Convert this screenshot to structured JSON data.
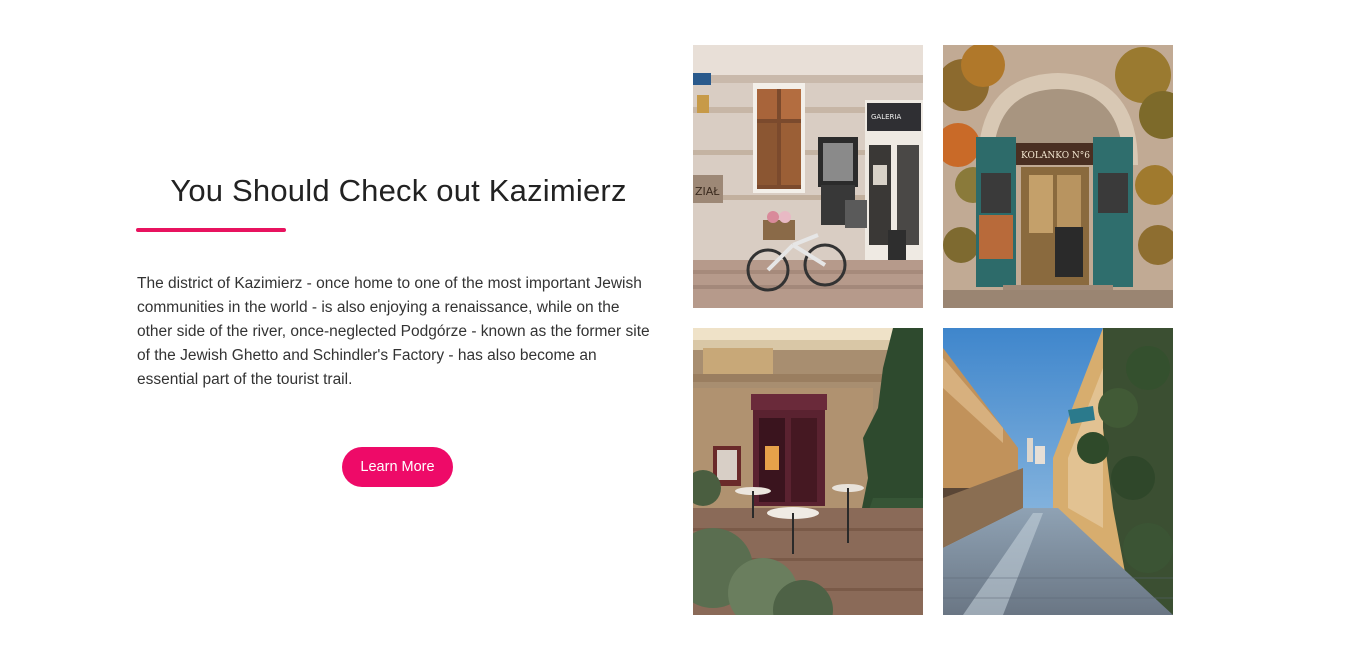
{
  "section": {
    "title": "You Should Check out Kazimierz",
    "description": "The district of Kazimierz - once home to one of the most important Jewish communities in the world - is also enjoying a renaissance, while on the other side of the river, once-neglected Podgórze - known as the former site of the Jewish Ghetto and Schindler's Factory - has also become an essential part of the tourist trail.",
    "button_label": "Learn More",
    "accent_color": "#e8135f",
    "button_color": "#ee0a68"
  },
  "gallery": {
    "photos": [
      {
        "subject": "galeria-storefront-with-bicycle",
        "sign_text": "GALERIA",
        "tag_left": "ZIAŁ"
      },
      {
        "subject": "kolanko-no6-ivy-doorway",
        "sign_text": "KOLANKO N°6"
      },
      {
        "subject": "courtyard-cafe-tables",
        "sign_text": ""
      },
      {
        "subject": "wet-cobbled-street"
      }
    ]
  }
}
